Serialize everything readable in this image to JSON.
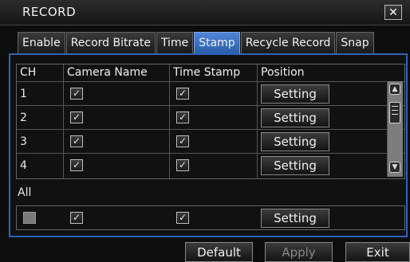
{
  "window": {
    "title": "RECORD",
    "close_glyph": "✕"
  },
  "tabs": [
    "Enable",
    "Record Bitrate",
    "Time",
    "Stamp",
    "Recycle Record",
    "Snap"
  ],
  "active_tab": "Stamp",
  "table": {
    "headers": [
      "CH",
      "Camera Name",
      "Time Stamp",
      "Position"
    ],
    "rows": [
      {
        "ch": "1",
        "camera_name": true,
        "time_stamp": true,
        "position": "Setting"
      },
      {
        "ch": "2",
        "camera_name": true,
        "time_stamp": true,
        "position": "Setting"
      },
      {
        "ch": "3",
        "camera_name": true,
        "time_stamp": true,
        "position": "Setting"
      },
      {
        "ch": "4",
        "camera_name": true,
        "time_stamp": true,
        "position": "Setting"
      }
    ]
  },
  "all": {
    "label": "All",
    "ch_checked": false,
    "camera_name": true,
    "time_stamp": true,
    "position": "Setting"
  },
  "check_glyph": "✓",
  "footer": {
    "default": "Default",
    "apply": "Apply",
    "exit": "Exit",
    "apply_disabled": true
  },
  "colors": {
    "accent": "#2d63b8",
    "active_tab": "#3a72c4"
  }
}
